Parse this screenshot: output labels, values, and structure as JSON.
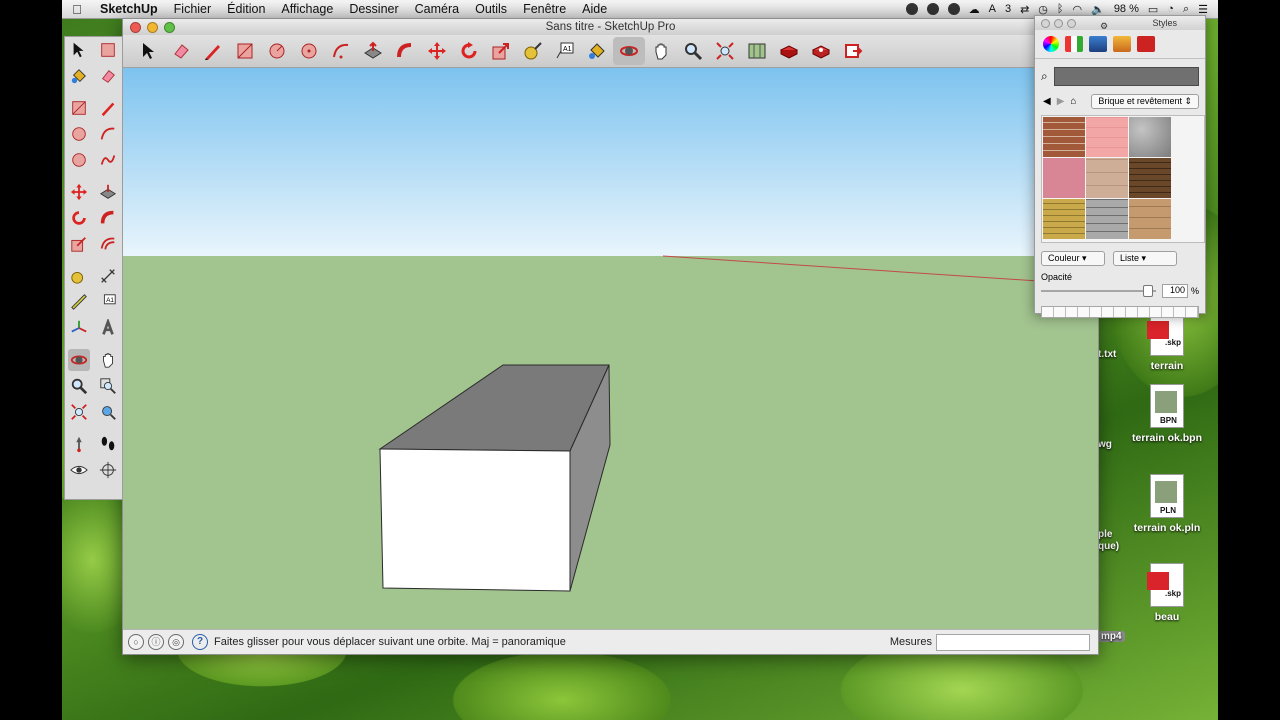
{
  "menubar": {
    "app": "SketchUp",
    "items": [
      "Fichier",
      "Édition",
      "Affichage",
      "Dessiner",
      "Caméra",
      "Outils",
      "Fenêtre",
      "Aide"
    ],
    "status_num": "3",
    "battery": "98 %"
  },
  "window": {
    "title": "Sans titre - SketchUp Pro"
  },
  "toolbar": {
    "tools": [
      "select-tool",
      "eraser-tool",
      "pencil-line-tool",
      "rectangle-tool",
      "circle-tool",
      "arc-tool",
      "push-pull-tool",
      "follow-me-tool",
      "move-tool",
      "rotate-tool",
      "scale-tool",
      "tape-measure-tool",
      "text-tool",
      "paint-bucket-tool",
      "orbit-tool",
      "pan-tool",
      "zoom-tool",
      "zoom-extents-tool",
      "add-location-tool",
      "component-tool",
      "warehouse-tool",
      "send-layout-tool"
    ]
  },
  "statusbar": {
    "hint": "Faites glisser pour vous déplacer suivant une orbite.  Maj = panoramique",
    "measure_label": "Mesures",
    "measure_value": ""
  },
  "styles_panel": {
    "title": "Styles",
    "search_placeholder": "",
    "collection": "Brique et revêtement",
    "color_mode": "Couleur",
    "view_mode": "Liste",
    "opacity_label": "Opacité",
    "opacity_value": "100",
    "opacity_unit": "%"
  },
  "desktop": {
    "icons": [
      {
        "label": "terrain",
        "ext": ".skp"
      },
      {
        "label": "terrain ok.bpn",
        "ext": "BPN"
      },
      {
        "label": "terrain ok.pln",
        "ext": "PLN"
      },
      {
        "label": "beau",
        "ext": ".skp"
      }
    ],
    "partials": [
      "t.txt",
      "wg",
      "ple",
      "que)",
      "mp4"
    ]
  }
}
